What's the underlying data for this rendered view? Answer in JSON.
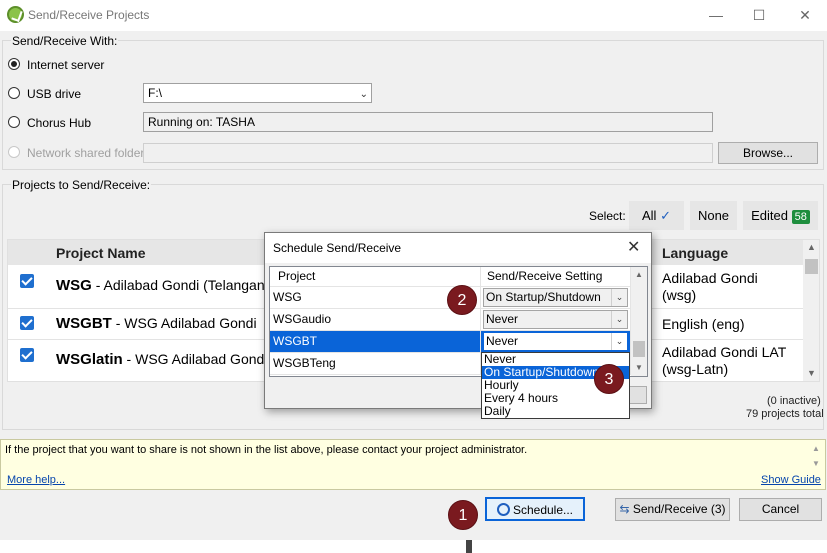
{
  "window": {
    "title": "Send/Receive Projects"
  },
  "send_with": {
    "group_label": "Send/Receive With:",
    "internet_label": "Internet server",
    "usb_label": "USB drive",
    "usb_value": "F:\\",
    "chorus_label": "Chorus Hub",
    "chorus_value": "Running on: TASHA",
    "network_label": "Network shared folder",
    "browse_label": "Browse..."
  },
  "projects": {
    "group_label": "Projects to Send/Receive:",
    "select_label": "Select:",
    "all_label": "All",
    "none_label": "None",
    "edited_label": "Edited",
    "edited_count": "58",
    "col_project": "Project Name",
    "col_language": "Language",
    "rows": [
      {
        "name": "WSG",
        "desc": " - Adilabad Gondi (Telangana)",
        "lang1": "Adilabad Gondi",
        "lang2": "(wsg)"
      },
      {
        "name": "WSGBT",
        "desc": " - WSG Adilabad Gondi",
        "lang1": "English (eng)",
        "lang2": ""
      },
      {
        "name": "WSGlatin",
        "desc": " - WSG Adilabad Gondi",
        "lang1": "Adilabad Gondi LAT",
        "lang2": "(wsg-Latn)"
      }
    ],
    "inactive": "(0 inactive)",
    "total": "79 projects total"
  },
  "info": {
    "message": "If the project that you want to share is not shown in the list above, please contact your project administrator.",
    "more_help": "More help...",
    "show_guide": "Show Guide"
  },
  "buttons": {
    "schedule": "Schedule...",
    "send_receive": "Send/Receive (3)",
    "cancel": "Cancel"
  },
  "dialog": {
    "title": "Schedule Send/Receive",
    "col_project": "Project",
    "col_setting": "Send/Receive Setting",
    "rows": [
      {
        "project": "WSG",
        "setting": "On Startup/Shutdown"
      },
      {
        "project": "WSGaudio",
        "setting": "Never"
      },
      {
        "project": "WSGBT",
        "setting": "Never"
      },
      {
        "project": "WSGBTeng",
        "setting": ""
      }
    ],
    "options": [
      "Never",
      "On Startup/Shutdown",
      "Hourly",
      "Every 4 hours",
      "Daily"
    ]
  },
  "markers": [
    "1",
    "2",
    "3"
  ],
  "colors": {
    "accent": "#0a64d8",
    "marker": "#7a1a1f",
    "edited_badge": "#1e8e3e"
  }
}
